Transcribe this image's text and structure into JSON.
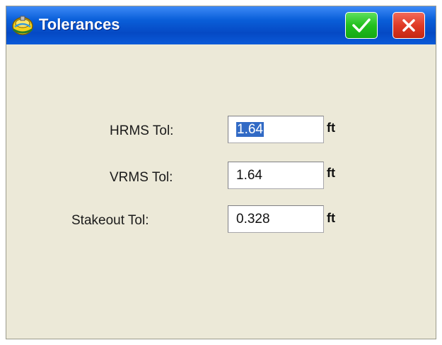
{
  "window": {
    "title": "Tolerances",
    "ok_icon": "checkmark-icon",
    "close_icon": "close-icon",
    "app_icon": "gps-device-icon",
    "colors": {
      "titlebar": "#0a5fd9",
      "ok": "#22c01e",
      "close": "#e03a26",
      "background": "#ece9d8",
      "selection": "#316ac5"
    }
  },
  "form": {
    "hrms": {
      "label": "HRMS Tol:",
      "value": "1.64",
      "unit": "ft"
    },
    "vrms": {
      "label": "VRMS Tol:",
      "value": "1.64",
      "unit": "ft"
    },
    "stakeout": {
      "label": "Stakeout Tol:",
      "value": "0.328",
      "unit": "ft"
    }
  }
}
